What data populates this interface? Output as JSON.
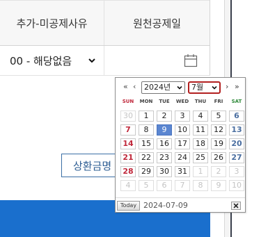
{
  "table": {
    "headers": [
      "추가-미공제사유",
      "원천공제일"
    ],
    "row": {
      "reason_value": "00 - 해당없음",
      "date_value": ""
    }
  },
  "repay_button_label": "상환금명",
  "datepicker": {
    "prev_year": "«",
    "prev_month": "‹",
    "next_month": "›",
    "next_year": "»",
    "year": "2024년",
    "month": "7월",
    "weekdays": [
      "SUN",
      "MON",
      "TUE",
      "WED",
      "THU",
      "FRI",
      "SAT"
    ],
    "weeks": [
      [
        "30",
        "1",
        "2",
        "3",
        "4",
        "5",
        "6"
      ],
      [
        "7",
        "8",
        "9",
        "10",
        "11",
        "12",
        "13"
      ],
      [
        "14",
        "15",
        "16",
        "17",
        "18",
        "19",
        "20"
      ],
      [
        "21",
        "22",
        "23",
        "24",
        "25",
        "26",
        "27"
      ],
      [
        "28",
        "29",
        "30",
        "31",
        "1",
        "2",
        "3"
      ],
      [
        "4",
        "5",
        "6",
        "7",
        "8",
        "9",
        "10"
      ]
    ],
    "selected_day": "9",
    "today_label": "Today",
    "current_date": "2024-07-09",
    "colors": {
      "sunday": "#c0283b",
      "saturday": "#4a6ea0",
      "selected": "#5b86d1",
      "month_highlight": "#b21f1f"
    }
  },
  "colors": {
    "primary_blue": "#1a6fcd",
    "button_border": "#3a6ea5"
  },
  "icons": [
    "chevron-down-icon",
    "calendar-icon",
    "close-icon"
  ]
}
